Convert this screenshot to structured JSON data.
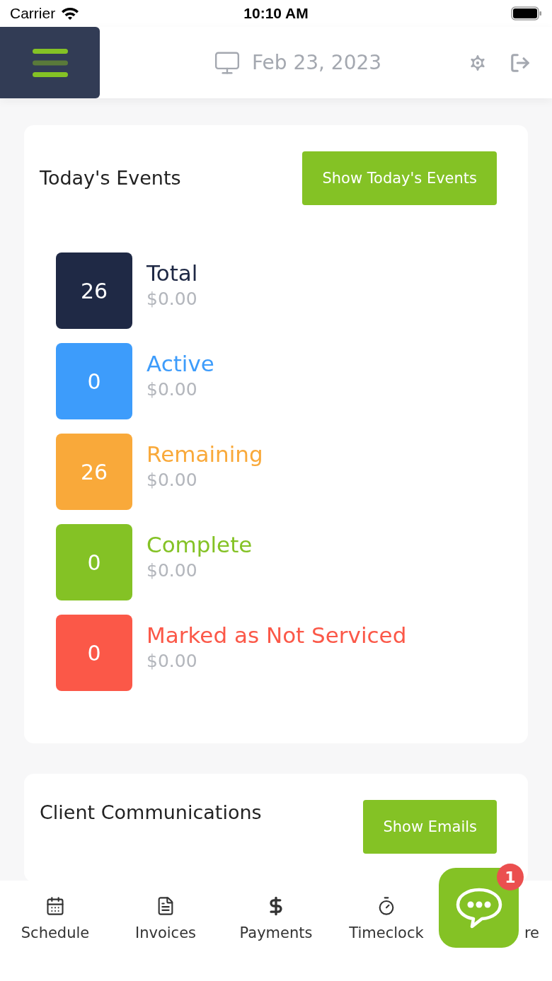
{
  "status_bar": {
    "carrier": "Carrier",
    "time": "10:10 AM"
  },
  "header": {
    "date": "Feb 23, 2023"
  },
  "events_card": {
    "title": "Today's Events",
    "button": "Show Today's Events",
    "stats": [
      {
        "count": "26",
        "label": "Total",
        "amount": "$0.00",
        "color": "#1f2945"
      },
      {
        "count": "0",
        "label": "Active",
        "amount": "$0.00",
        "color": "#3d9cfb"
      },
      {
        "count": "26",
        "label": "Remaining",
        "amount": "$0.00",
        "color": "#f9a93a"
      },
      {
        "count": "0",
        "label": "Complete",
        "amount": "$0.00",
        "color": "#84c225"
      },
      {
        "count": "0",
        "label": "Marked as Not Serviced",
        "amount": "$0.00",
        "color": "#fb5848"
      }
    ]
  },
  "communications_card": {
    "title": "Client Communications",
    "button": "Show Emails"
  },
  "tab_bar": [
    {
      "kind": "schedule",
      "label": "Schedule"
    },
    {
      "kind": "invoices",
      "label": "Invoices"
    },
    {
      "kind": "payments",
      "label": "Payments"
    },
    {
      "kind": "timeclock",
      "label": "Timeclock"
    },
    {
      "kind": "more",
      "label": "re"
    }
  ],
  "chat_button": {
    "badge": "1"
  }
}
